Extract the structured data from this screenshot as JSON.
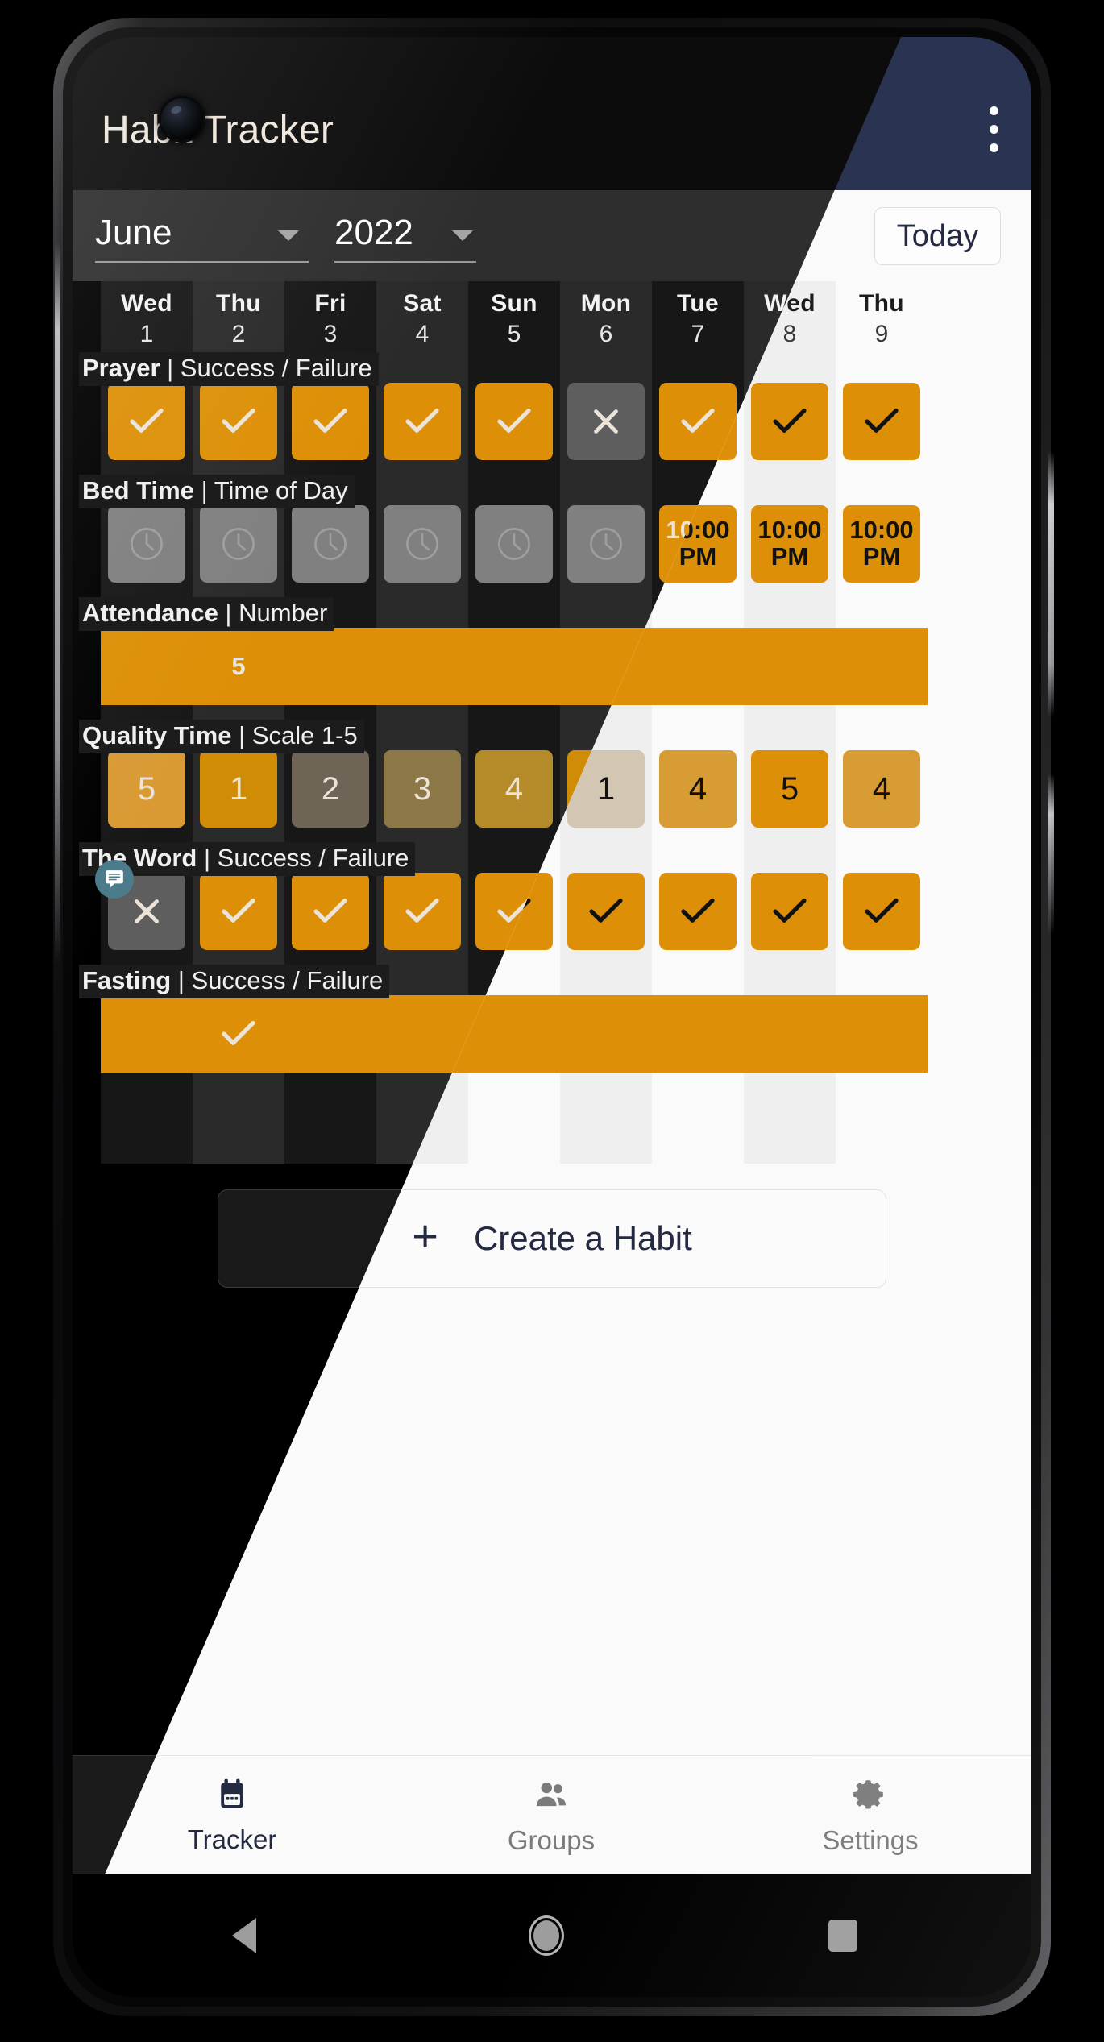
{
  "app": {
    "title": "Habit Tracker",
    "overflow_menu_icon": "kebab-menu-icon"
  },
  "monthbar": {
    "month": "June",
    "year": "2022",
    "today_label": "Today",
    "month_caret_icon": "chevron-down-icon",
    "year_caret_icon": "chevron-down-icon"
  },
  "days": [
    {
      "dow": "Wed",
      "num": "1"
    },
    {
      "dow": "Thu",
      "num": "2"
    },
    {
      "dow": "Fri",
      "num": "3"
    },
    {
      "dow": "Sat",
      "num": "4"
    },
    {
      "dow": "Sun",
      "num": "5"
    },
    {
      "dow": "Mon",
      "num": "6"
    },
    {
      "dow": "Tue",
      "num": "7"
    },
    {
      "dow": "Wed",
      "num": "8"
    },
    {
      "dow": "Thu",
      "num": "9"
    }
  ],
  "habits": [
    {
      "name": "Prayer",
      "type": "Success / Failure",
      "separator": "|",
      "style": "tile",
      "cells": [
        {
          "state": "success",
          "glyph": "check-icon"
        },
        {
          "state": "success",
          "glyph": "check-icon"
        },
        {
          "state": "success",
          "glyph": "check-icon"
        },
        {
          "state": "success",
          "glyph": "check-icon"
        },
        {
          "state": "success",
          "glyph": "check-icon"
        },
        {
          "state": "failure",
          "glyph": "close-icon"
        },
        {
          "state": "success",
          "glyph": "check-icon"
        },
        {
          "state": "success",
          "glyph": "check-icon"
        },
        {
          "state": "success",
          "glyph": "check-icon"
        }
      ]
    },
    {
      "name": "Bed Time",
      "type": "Time of Day",
      "separator": "|",
      "style": "tile",
      "cells": [
        {
          "state": "empty",
          "glyph": "clock-icon"
        },
        {
          "state": "empty",
          "glyph": "clock-icon"
        },
        {
          "state": "empty",
          "glyph": "clock-icon"
        },
        {
          "state": "empty",
          "glyph": "clock-icon"
        },
        {
          "state": "empty",
          "glyph": "clock-icon"
        },
        {
          "state": "empty",
          "glyph": "clock-icon"
        },
        {
          "state": "filled",
          "value": "10:00 PM"
        },
        {
          "state": "filled",
          "value": "10:00 PM"
        },
        {
          "state": "filled",
          "value": "10:00 PM"
        }
      ]
    },
    {
      "name": "Attendance",
      "type": "Number",
      "separator": "|",
      "style": "bar",
      "cells": [
        {
          "state": "filled",
          "value": ""
        },
        {
          "state": "filled",
          "value": "5"
        },
        {
          "state": "filled",
          "value": ""
        },
        {
          "state": "filled",
          "value": ""
        },
        {
          "state": "filled",
          "value": ""
        },
        {
          "state": "filled",
          "value": ""
        },
        {
          "state": "filled",
          "value": ""
        },
        {
          "state": "filled",
          "value": ""
        },
        {
          "state": "filled",
          "value": ""
        }
      ]
    },
    {
      "name": "Quality Time",
      "type": "Scale 1-5",
      "separator": "|",
      "style": "tile",
      "cells": [
        {
          "state": "scale",
          "value": "5",
          "level": 5
        },
        {
          "state": "scale",
          "value": "1",
          "level": 1
        },
        {
          "state": "scale",
          "value": "2",
          "level": 2
        },
        {
          "state": "scale",
          "value": "3",
          "level": 3
        },
        {
          "state": "scale",
          "value": "4",
          "level": 4
        },
        {
          "state": "scale",
          "value": "1",
          "level": 1
        },
        {
          "state": "scale",
          "value": "4",
          "level": 4
        },
        {
          "state": "scale",
          "value": "5",
          "level": 5
        },
        {
          "state": "scale",
          "value": "4",
          "level": 4
        }
      ]
    },
    {
      "name": "The Word",
      "type": "Success / Failure",
      "separator": "|",
      "style": "tile",
      "cells": [
        {
          "state": "failure",
          "glyph": "close-icon",
          "note": true,
          "note_icon": "note-comment-icon"
        },
        {
          "state": "success",
          "glyph": "check-icon"
        },
        {
          "state": "success",
          "glyph": "check-icon"
        },
        {
          "state": "success",
          "glyph": "check-icon"
        },
        {
          "state": "success",
          "glyph": "check-icon"
        },
        {
          "state": "success",
          "glyph": "check-icon"
        },
        {
          "state": "success",
          "glyph": "check-icon"
        },
        {
          "state": "success",
          "glyph": "check-icon"
        },
        {
          "state": "success",
          "glyph": "check-icon"
        }
      ]
    },
    {
      "name": "Fasting",
      "type": "Success / Failure",
      "separator": "|",
      "style": "bar",
      "cells": [
        {
          "state": "filled"
        },
        {
          "state": "filled",
          "glyph": "check-icon"
        },
        {
          "state": "filled"
        },
        {
          "state": "filled"
        },
        {
          "state": "filled"
        },
        {
          "state": "filled"
        },
        {
          "state": "filled"
        },
        {
          "state": "filled"
        },
        {
          "state": "filled"
        }
      ]
    }
  ],
  "create_habit": {
    "label": "Create a Habit",
    "plus": "+",
    "plus_icon": "plus-icon"
  },
  "bottom_nav": [
    {
      "label": "Tracker",
      "icon": "calendar-icon",
      "active": true
    },
    {
      "label": "Groups",
      "icon": "people-icon",
      "active": false
    },
    {
      "label": "Settings",
      "icon": "gear-icon",
      "active": false
    }
  ],
  "system_nav": {
    "back": "back-triangle-icon",
    "home": "home-circle-icon",
    "recents": "recents-square-icon"
  },
  "colors": {
    "accent_orange": "#dd9007",
    "accent_orange_light": "#d99a33",
    "toolbar_light": "#2b3352",
    "today_text_dark": "#f5a314",
    "note_badge": "#4c7b8c",
    "dark_bg": "#171717",
    "light_bg": "#fafafa",
    "empty_cell_dark": "#808080",
    "failure_cell": "#5e5e5e"
  }
}
